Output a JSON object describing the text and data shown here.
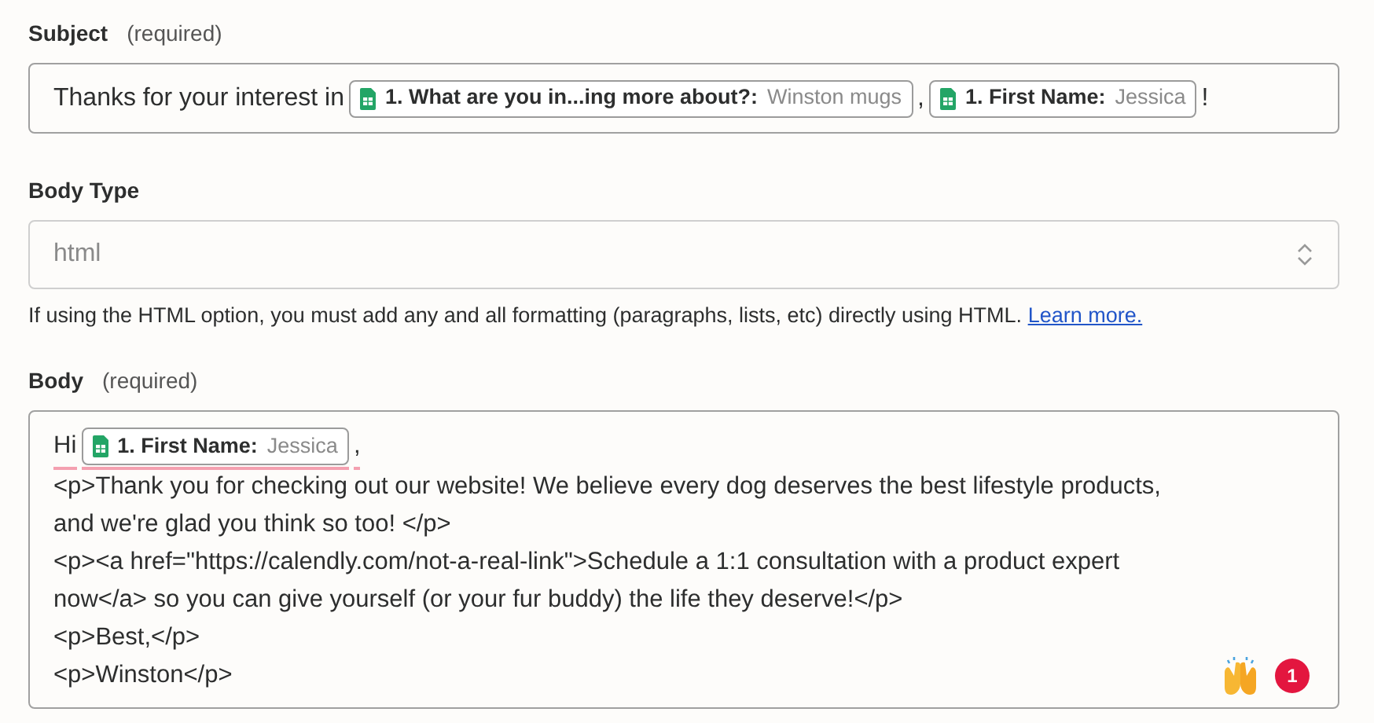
{
  "subject": {
    "label": "Subject",
    "required": "(required)",
    "segments": [
      {
        "kind": "text",
        "text": "Thanks for your interest in"
      },
      {
        "kind": "chip",
        "label": "1. What are you in...ing more about?:",
        "value": "Winston mugs"
      },
      {
        "kind": "text",
        "text": ","
      },
      {
        "kind": "chip",
        "label": "1. First Name:",
        "value": "Jessica"
      },
      {
        "kind": "text",
        "text": "!"
      }
    ]
  },
  "body_type": {
    "label": "Body Type",
    "value": "html",
    "hint": "If using the HTML option, you must add any and all formatting (paragraphs, lists, etc) directly using HTML.",
    "link": "Learn more."
  },
  "body": {
    "label": "Body",
    "required": "(required)",
    "greeting": [
      {
        "kind": "text",
        "text": "Hi",
        "flagged": true
      },
      {
        "kind": "chip",
        "label": "1. First Name:",
        "value": "Jessica",
        "flagged": true
      },
      {
        "kind": "text",
        "text": ",",
        "flagged": true
      }
    ],
    "lines": [
      "<p>Thank you for checking out our website! We believe every dog deserves the best lifestyle products,",
      "and we're glad you think so too! </p>",
      "<p><a href=\"https://calendly.com/not-a-real-link\">Schedule a 1:1 consultation with a product expert",
      "now</a> so you can give yourself (or your fur buddy) the life they deserve!</p>",
      "<p>Best,</p>",
      "<p>Winston</p>"
    ],
    "badge": "1"
  }
}
